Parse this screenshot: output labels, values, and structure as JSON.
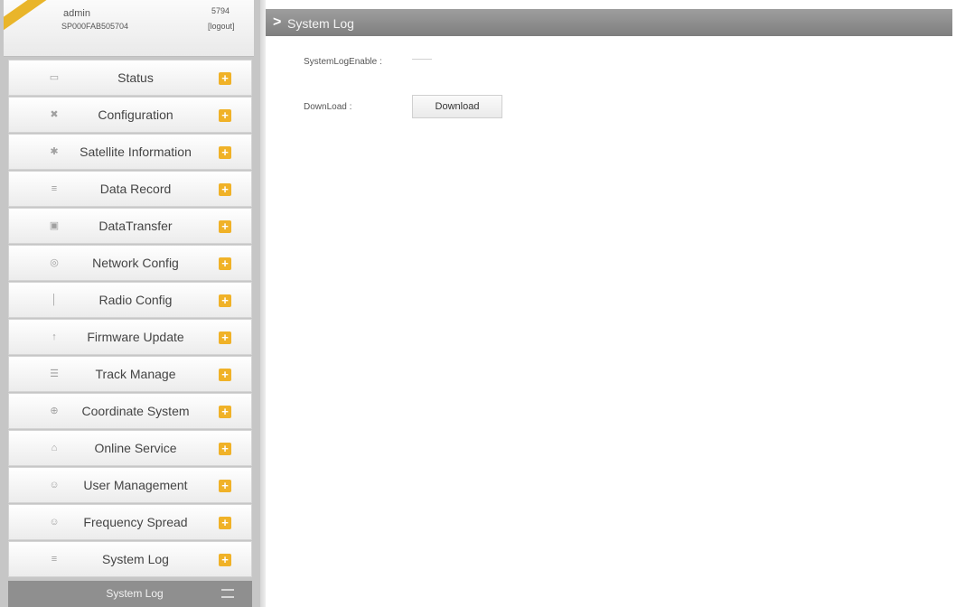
{
  "user": {
    "name": "admin",
    "serial": "SP000FAB505704",
    "id": "5794",
    "logout": "[logout]"
  },
  "menu": [
    {
      "label": "Status",
      "icon": "▭"
    },
    {
      "label": "Configuration",
      "icon": "✖"
    },
    {
      "label": "Satellite Information",
      "icon": "✱"
    },
    {
      "label": "Data Record",
      "icon": "≡"
    },
    {
      "label": "DataTransfer",
      "icon": "▣"
    },
    {
      "label": "Network Config",
      "icon": "◎"
    },
    {
      "label": "Radio Config",
      "icon": "│"
    },
    {
      "label": "Firmware Update",
      "icon": "↑"
    },
    {
      "label": "Track Manage",
      "icon": "☰"
    },
    {
      "label": "Coordinate System",
      "icon": "⊕"
    },
    {
      "label": "Online Service",
      "icon": "⌂"
    },
    {
      "label": "User Management",
      "icon": "☺"
    },
    {
      "label": "Frequency Spread",
      "icon": "☺"
    },
    {
      "label": "System Log",
      "icon": "≡"
    }
  ],
  "menu_expand_glyph": "+",
  "submenu": {
    "active_label": "System Log"
  },
  "header": {
    "arrow": ">",
    "title": "System Log"
  },
  "form": {
    "enable_label": "SystemLogEnable :",
    "download_label": "DownLoad :",
    "download_button": "Download"
  },
  "colors": {
    "accent": "#f0b228",
    "header_bg": "#8a8a8a",
    "sidebar_bg": "#c6c6c6",
    "submenu_bg": "#8f8f8f"
  }
}
